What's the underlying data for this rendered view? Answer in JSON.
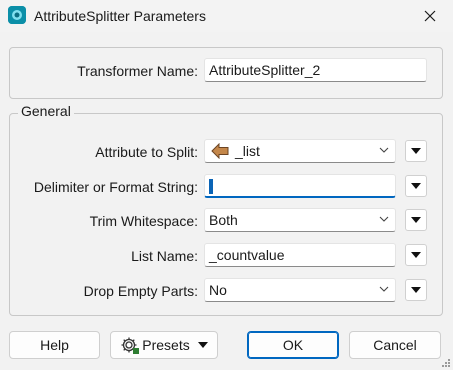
{
  "window": {
    "title": "AttributeSplitter Parameters",
    "accent_color": "#0067c0",
    "app_icon_color": "#0b8fa8"
  },
  "form": {
    "transformer_name_label": "Transformer Name:",
    "transformer_name_value": "AttributeSplitter_2",
    "general_group_label": "General",
    "attribute_to_split_label": "Attribute to Split:",
    "attribute_to_split_value": "_list",
    "attribute_icon": "attribute-arrow-icon",
    "delimiter_label": "Delimiter or Format String:",
    "delimiter_value": "",
    "trim_whitespace_label": "Trim Whitespace:",
    "trim_whitespace_value": "Both",
    "list_name_label": "List Name:",
    "list_name_value": "_countvalue",
    "drop_empty_parts_label": "Drop Empty Parts:",
    "drop_empty_parts_value": "No"
  },
  "buttons": {
    "help": "Help",
    "presets": "Presets",
    "ok": "OK",
    "cancel": "Cancel"
  }
}
